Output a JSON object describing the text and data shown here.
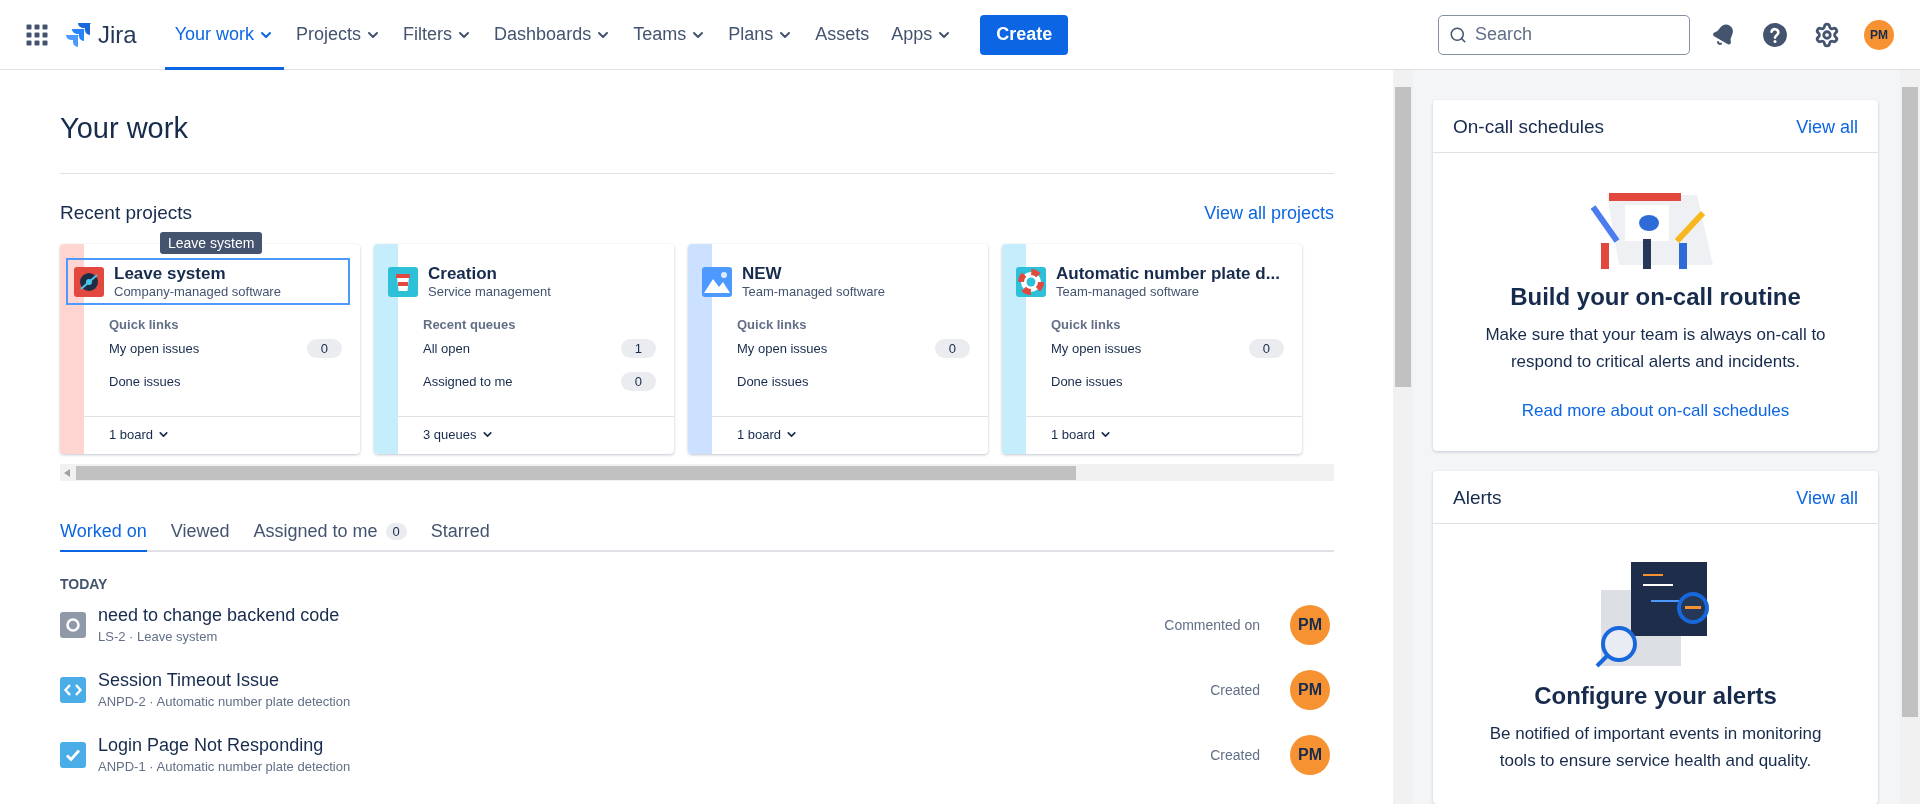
{
  "nav": {
    "product": "Jira",
    "items": [
      {
        "label": "Your work",
        "selected": true,
        "dropdown": true
      },
      {
        "label": "Projects",
        "selected": false,
        "dropdown": true
      },
      {
        "label": "Filters",
        "selected": false,
        "dropdown": true
      },
      {
        "label": "Dashboards",
        "selected": false,
        "dropdown": true
      },
      {
        "label": "Teams",
        "selected": false,
        "dropdown": true
      },
      {
        "label": "Plans",
        "selected": false,
        "dropdown": true
      },
      {
        "label": "Assets",
        "selected": false,
        "dropdown": false
      },
      {
        "label": "Apps",
        "selected": false,
        "dropdown": true
      }
    ],
    "create": "Create",
    "search": {
      "placeholder": "Search"
    },
    "avatar": "PM"
  },
  "page": {
    "title": "Your work"
  },
  "recent_projects": {
    "heading": "Recent projects",
    "link": "View all projects",
    "tooltip": "Leave system",
    "projects": [
      {
        "name": "Leave system",
        "type": "Company-managed software",
        "color": "#ffd5d2",
        "kind": "disc",
        "focused": true,
        "section": "Quick links",
        "links": [
          {
            "label": "My open issues",
            "count": "0"
          },
          {
            "label": "Done issues"
          }
        ],
        "footer": "1 board"
      },
      {
        "name": "Creation",
        "type": "Service management",
        "color": "#c6edfb",
        "kind": "cup",
        "focused": false,
        "section": "Recent queues",
        "links": [
          {
            "label": "All open",
            "count": "1"
          },
          {
            "label": "Assigned to me",
            "count": "0"
          }
        ],
        "footer": "3 queues"
      },
      {
        "name": "NEW",
        "type": "Team-managed software",
        "color": "#cce0ff",
        "kind": "mountain",
        "focused": false,
        "section": "Quick links",
        "links": [
          {
            "label": "My open issues",
            "count": "0"
          },
          {
            "label": "Done issues"
          }
        ],
        "footer": "1 board"
      },
      {
        "name": "Automatic number plate d...",
        "type": "Team-managed software",
        "color": "#c6edfb",
        "kind": "lifebuoy",
        "focused": false,
        "section": "Quick links",
        "links": [
          {
            "label": "My open issues",
            "count": "0"
          },
          {
            "label": "Done issues"
          }
        ],
        "footer": "1 board"
      }
    ]
  },
  "tabs": [
    {
      "label": "Worked on",
      "selected": true
    },
    {
      "label": "Viewed",
      "selected": false
    },
    {
      "label": "Assigned to me",
      "count": "0",
      "selected": false
    },
    {
      "label": "Starred",
      "selected": false
    }
  ],
  "group": "TODAY",
  "items": [
    {
      "kind": "subtask",
      "title": "need to change backend code",
      "meta": "LS-2  ·  Leave system",
      "action": "Commented on",
      "avatar": "PM"
    },
    {
      "kind": "code",
      "title": "Session Timeout Issue",
      "meta": "ANPD-2  ·  Automatic number plate detection",
      "action": "Created",
      "avatar": "PM"
    },
    {
      "kind": "task",
      "title": "Login Page Not Responding",
      "meta": "ANPD-1  ·  Automatic number plate detection",
      "action": "Created",
      "avatar": "PM"
    }
  ],
  "sidebar": [
    {
      "kind": "calendar",
      "title": "On-call schedules",
      "link": "View all",
      "heading": "Build your on-call routine",
      "text": "Make sure that your team is always on-call to respond to critical alerts and incidents.",
      "more": "Read more about on-call schedules"
    },
    {
      "kind": "alerts",
      "title": "Alerts",
      "link": "View all",
      "heading": "Configure your alerts",
      "text": "Be notified of important events in monitoring tools to ensure service health and quality."
    }
  ]
}
